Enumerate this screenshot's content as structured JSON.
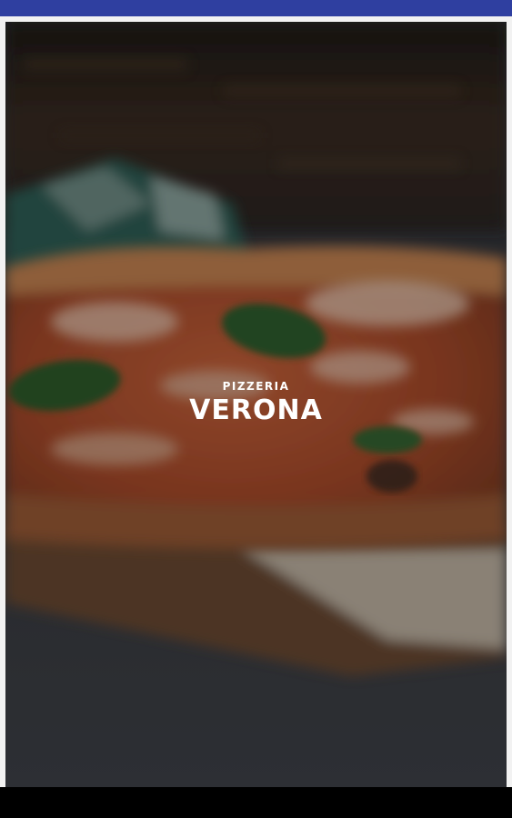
{
  "colors": {
    "status_bar": "#2f3fa0",
    "nav_bar": "#000000",
    "brand_text": "#ffffff"
  },
  "hero": {
    "image": "pizza-background-image",
    "brand_subtitle": "PIZZERIA",
    "brand_title": "VERONA"
  }
}
